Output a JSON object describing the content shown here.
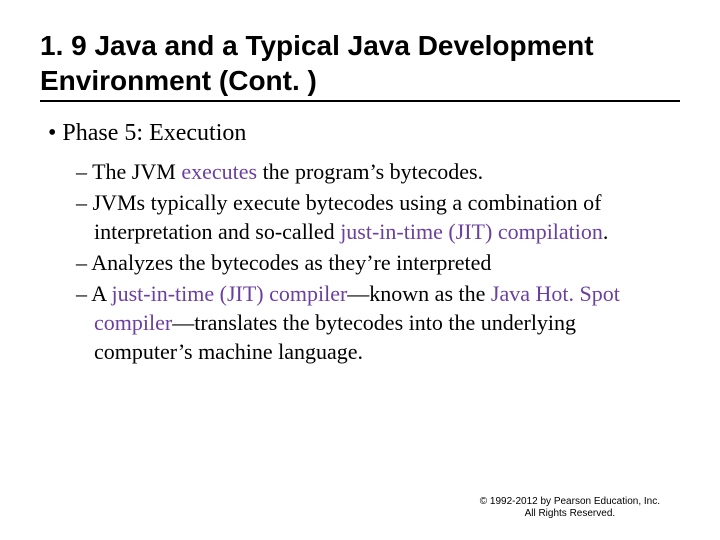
{
  "title": "1. 9  Java and a Typical Java Development Environment (Cont. )",
  "bullet1": "• Phase 5: Execution",
  "sub": {
    "s1a": "– The JVM ",
    "s1b": "executes",
    "s1c": " the program’s bytecodes.",
    "s2a": "– JVMs typically execute bytecodes using a combination of interpretation and so-called ",
    "s2b": "just-in-time (JIT) compilation",
    "s2c": ".",
    "s3": "– Analyzes the bytecodes as they’re interpreted",
    "s4a": "– A ",
    "s4b": "just-in-time (JIT) compiler",
    "s4c": "—known as the ",
    "s4d": "Java Hot. Spot compiler",
    "s4e": "—translates the bytecodes into the underlying computer’s machine language."
  },
  "footer": {
    "line1": "© 1992-2012 by Pearson Education, Inc.",
    "line2": "All Rights Reserved."
  }
}
